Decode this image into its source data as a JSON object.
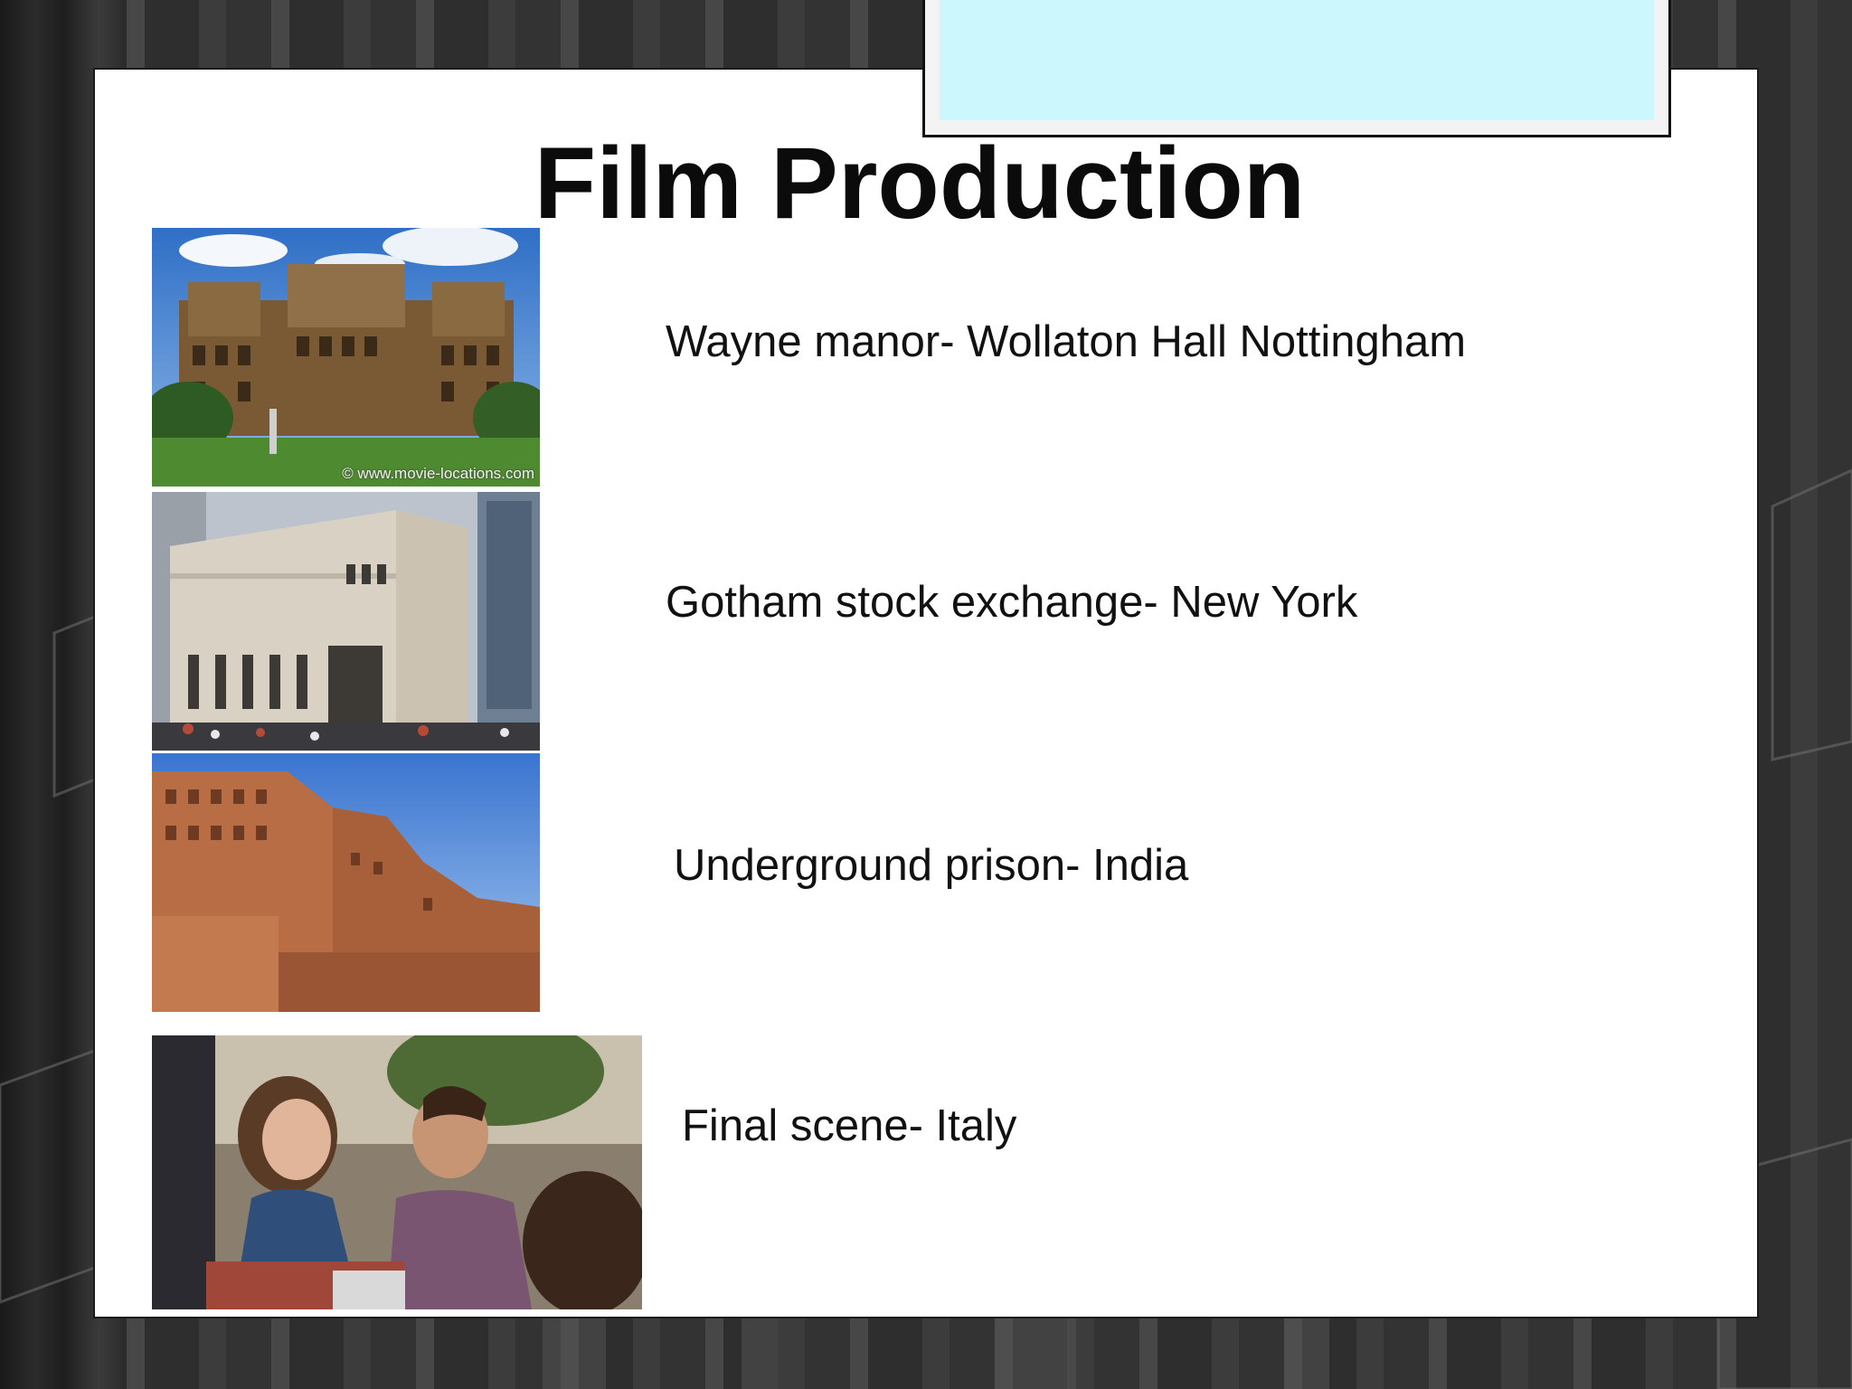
{
  "slide": {
    "title": "Film Production",
    "items": [
      {
        "caption": "Wayne manor- Wollaton Hall Nottingham",
        "image": "wollaton-hall-photo",
        "watermark": "© www.movie-locations.com"
      },
      {
        "caption": "Gotham stock exchange- New York",
        "image": "stock-exchange-building-photo"
      },
      {
        "caption": "Underground prison- India",
        "image": "indian-fort-photo"
      },
      {
        "caption": "Final scene- Italy",
        "image": "cafe-scene-photo"
      }
    ]
  },
  "colors": {
    "slide_background": "#ffffff",
    "accent_box": "#ccf7fd",
    "title_text": "#0b0b0b"
  }
}
